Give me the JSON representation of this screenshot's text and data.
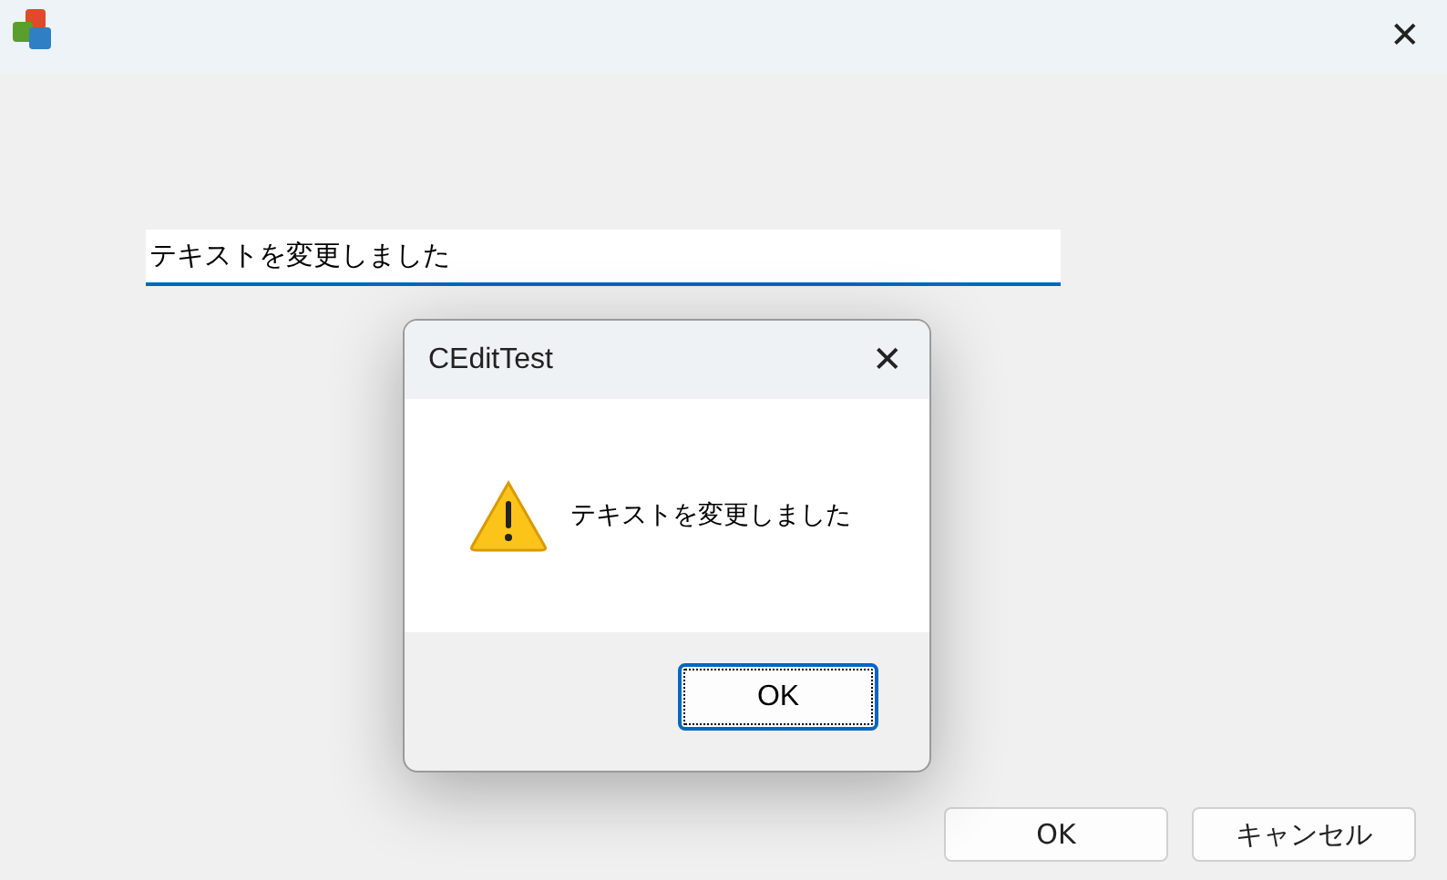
{
  "window": {
    "close": "✕"
  },
  "edit": {
    "value": "テキストを変更しました"
  },
  "buttons": [
    {
      "label": "OK"
    },
    {
      "label": "キャンセル"
    }
  ],
  "dialog": {
    "title": "CEditTest",
    "close": "✕",
    "icon": {
      "kind": "warning"
    },
    "message": "テキストを変更しました",
    "buttons": [
      {
        "label": "OK",
        "focused": true
      }
    ]
  }
}
